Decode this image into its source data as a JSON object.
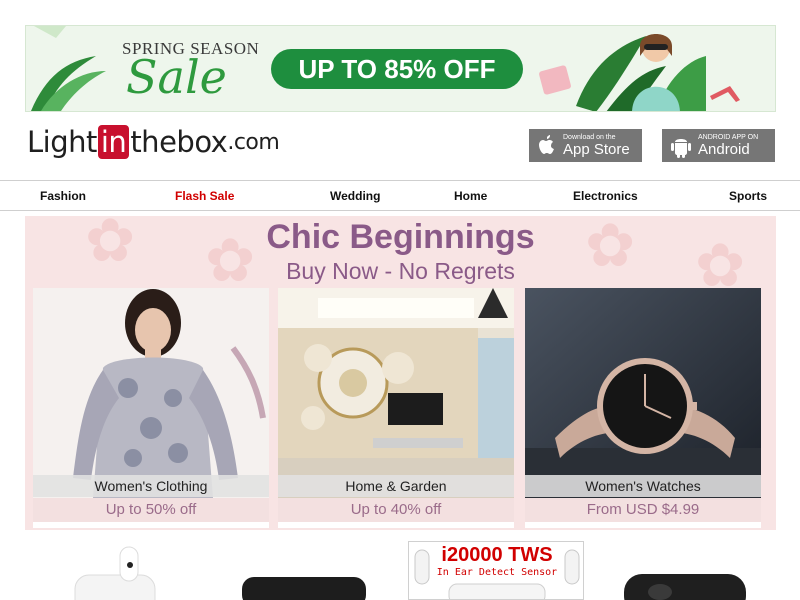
{
  "promo": {
    "season": "SPRING SEASON",
    "sale": "Sale",
    "offer": "UP TO 85% OFF"
  },
  "logo": {
    "left": "Light",
    "mid": "in",
    "right": "thebox",
    "suffix": ".com"
  },
  "apps": {
    "ios_small": "Download on the",
    "ios_big": "App Store",
    "android_small": "ANDROID APP ON",
    "android_big": "Android"
  },
  "nav": {
    "items": [
      "Fashion",
      "Flash Sale",
      "Wedding",
      "Home",
      "Electronics",
      "Sports"
    ]
  },
  "chic": {
    "title": "Chic Beginnings",
    "subtitle": "Buy Now - No Regrets",
    "cards": [
      {
        "caption": "Women's Clothing",
        "deal": "Up to 50% off"
      },
      {
        "caption": "Home & Garden",
        "deal": "Up to 40% off"
      },
      {
        "caption": "Women's Watches",
        "deal": "From USD $4.99"
      }
    ]
  },
  "bottom": {
    "tws_title": "i20000 TWS",
    "tws_sub": "In Ear Detect Sensor"
  },
  "colors": {
    "brand_red": "#c8102e",
    "promo_green": "#1e8e3e",
    "chic_purple": "#8a5a88",
    "flash_red": "#d10000"
  }
}
